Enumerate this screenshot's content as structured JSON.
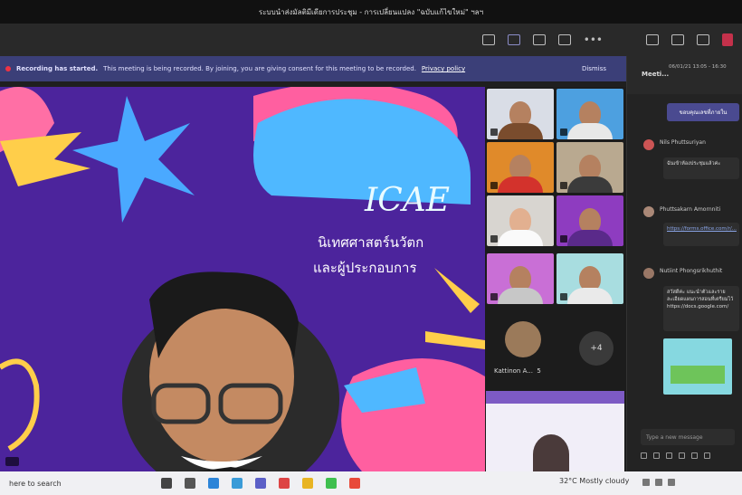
{
  "window": {
    "title": "ระบบนำส่งมัลติมีเดียการประชุม - การเปลี่ยนแปลง \"ฉบับแก้ไขใหม่\" ฯลฯ"
  },
  "toolbar": {
    "icons": [
      "participants-icon",
      "chat-icon",
      "reactions-icon",
      "rooms-icon",
      "more-icon",
      "camera-icon",
      "mic-icon",
      "share-icon",
      "leave-icon"
    ]
  },
  "banner": {
    "status": "Recording has started.",
    "message": "This meeting is being recorded. By joining, you are giving consent for this meeting to be recorded.",
    "link": "Privacy policy",
    "dismiss": "Dismiss"
  },
  "stage": {
    "logo": "ICAE",
    "subtitle_line1": "นิเทศศาสตร์นวัตก",
    "subtitle_line2": "และผู้ประกอบการ"
  },
  "gallery": {
    "overflow_name": "Kattinon A...",
    "overflow_badge": "5",
    "more_count": "+4"
  },
  "chat": {
    "title": "Meeti...",
    "meeting_time": "06/01/21 13:05 - 16:30",
    "action_button": "ขอบคุณเลขที่ภายใน",
    "messages": [
      {
        "sender": "Nils Phuttsuriyan",
        "text": "ฉันเข้าห้องประชุมแล้วค่ะ"
      },
      {
        "sender": "Phuttsakarn Amornniti",
        "text": "https://forms.office.com/r/..."
      },
      {
        "sender": "Nutiint Phongsrikhuthit",
        "text": "สวัสดีค่ะ แนะนำตัวและรายละเอียดแผนการสอนที่เตรียมไว้ https://docs.google.com/"
      }
    ],
    "compose_placeholder": "Type a new message"
  },
  "taskbar": {
    "search": "here to search",
    "weather": "32°C  Mostly cloudy"
  }
}
